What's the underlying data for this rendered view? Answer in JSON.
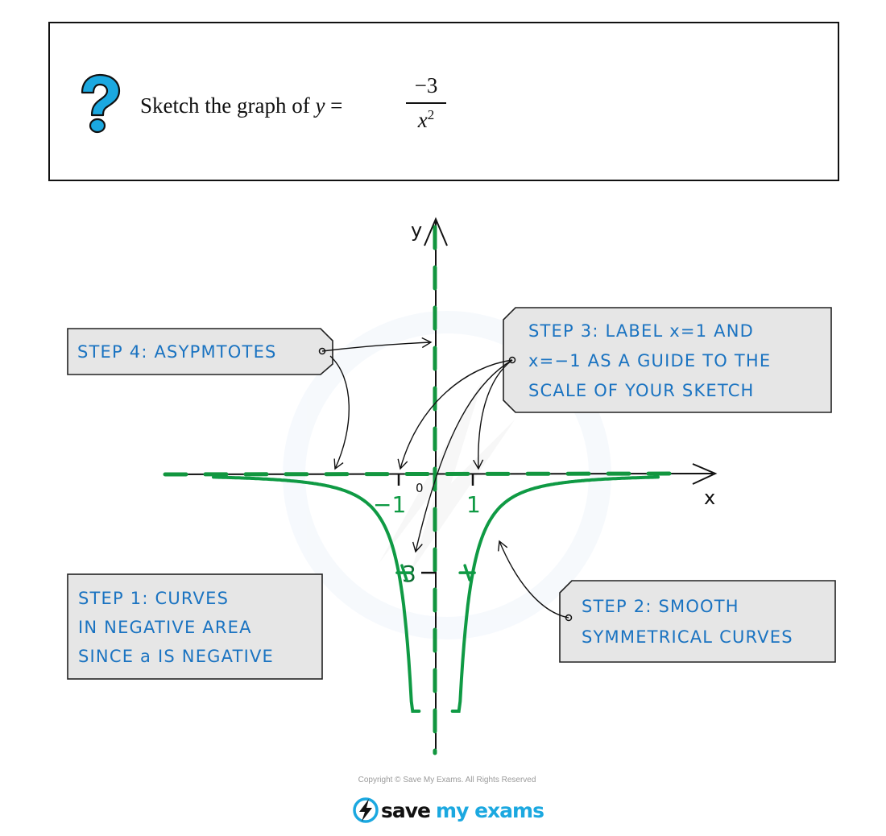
{
  "question": {
    "icon": "question-mark-icon",
    "prompt": "Sketch the graph of ",
    "variable": "y",
    "equals": " =",
    "numerator": "−3",
    "denominator_base": "x",
    "denominator_exp": "2"
  },
  "callouts": {
    "step1": {
      "lines": [
        "STEP 1:  CURVES",
        "IN NEGATIVE  AREA",
        "SINCE  a  IS  NEGATIVE"
      ]
    },
    "step2": {
      "lines": [
        "STEP 2:  SMOOTH",
        "SYMMETRICAL  CURVES"
      ]
    },
    "step3": {
      "lines": [
        "STEP 3:  LABEL  x=1 AND",
        "x=−1  AS  A  GUIDE  TO  THE",
        "SCALE  OF  YOUR  SKETCH"
      ]
    },
    "step4": {
      "lines": [
        "STEP 4:  ASYPMTOTES"
      ]
    }
  },
  "chart_data": {
    "type": "line",
    "title": "y = -3/x^2",
    "function": "y = -3 / x^2",
    "xlabel": "x",
    "ylabel": "y",
    "origin_label": "0",
    "x_ticks": [
      {
        "value": -1,
        "label": "−1"
      },
      {
        "value": 1,
        "label": "1"
      }
    ],
    "y_ticks": [
      {
        "value": -3,
        "label": "−3"
      }
    ],
    "marked_points": [
      {
        "x": -1,
        "y": -3
      },
      {
        "x": 1,
        "y": -3
      }
    ],
    "asymptotes": [
      {
        "type": "vertical",
        "value": 0
      },
      {
        "type": "horizontal",
        "value": 0
      }
    ],
    "xlim": [
      -7,
      7
    ],
    "ylim": [
      -8.5,
      7.5
    ],
    "series": [
      {
        "name": "left-branch",
        "x_range": [
          -6,
          -0.45
        ]
      },
      {
        "name": "right-branch",
        "x_range": [
          0.45,
          6
        ]
      }
    ]
  },
  "colors": {
    "curve": "#0f9a44",
    "asymptote": "#12963f",
    "axis": "#111111",
    "callout_fill": "#e6e6e6",
    "callout_text": "#1a73c1",
    "question_icon": "#1ba8e0"
  },
  "footer": {
    "copyright": "Copyright © Save My Exams. All Rights Reserved",
    "logo_word1": "save",
    "logo_word2": "my exams"
  }
}
